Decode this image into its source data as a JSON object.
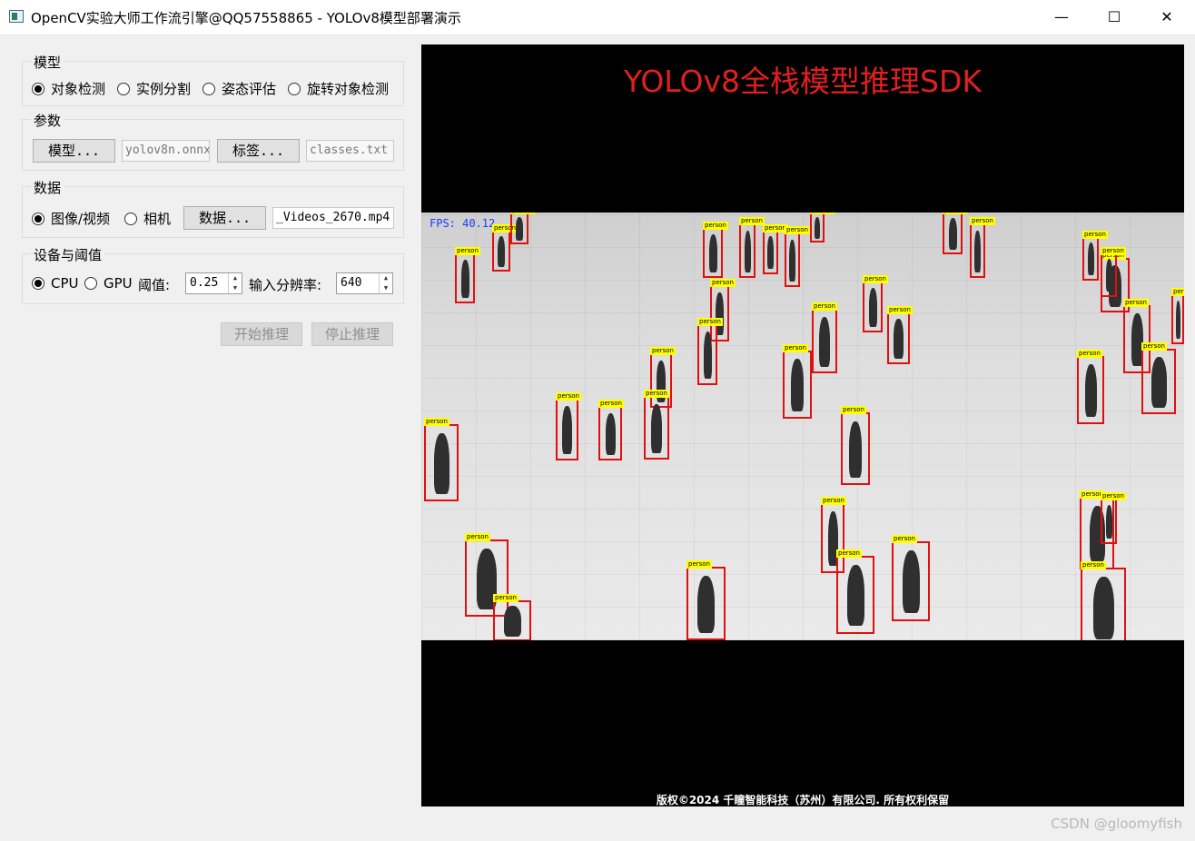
{
  "window": {
    "title": "OpenCV实验大师工作流引擎@QQ57558865 - YOLOv8模型部署演示",
    "minimize": "—",
    "maximize": "☐",
    "close": "✕"
  },
  "model_group": {
    "label": "模型",
    "options": [
      "对象检测",
      "实例分割",
      "姿态评估",
      "旋转对象检测"
    ],
    "selected": "对象检测"
  },
  "params_group": {
    "label": "参数",
    "model_button": "模型...",
    "model_path": "yolov8n.onnx",
    "label_button": "标签...",
    "label_path": "classes.txt"
  },
  "data_group": {
    "label": "数据",
    "options": [
      "图像/视频",
      "相机"
    ],
    "selected": "图像/视频",
    "data_button": "数据...",
    "data_path": "_Videos_2670.mp4"
  },
  "device_group": {
    "label": "设备与阈值",
    "options": [
      "CPU",
      "GPU"
    ],
    "selected": "CPU",
    "threshold_label": "阈值:",
    "threshold_value": "0.25",
    "resolution_label": "输入分辨率:",
    "resolution_value": "640"
  },
  "actions": {
    "start": "开始推理",
    "stop": "停止推理"
  },
  "display": {
    "overlay_title": "YOLOv8全栈模型推理SDK",
    "fps_text": "FPS: 40.12",
    "detection_label": "person",
    "copyright": "版权©2024 千瞳智能科技（苏州）有限公司. 所有权利保留"
  },
  "colors": {
    "box": "#e01010",
    "tag": "#ffff00",
    "overlay_title": "#e02020",
    "fps": "#1a3cff"
  },
  "watermark": "CSDN @gloomyfish"
}
